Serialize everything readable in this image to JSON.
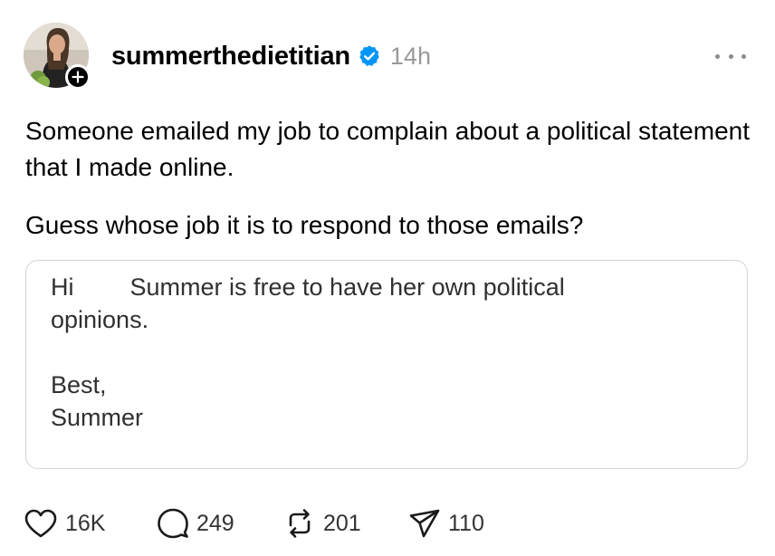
{
  "post": {
    "username": "summerthedietitian",
    "timestamp": "14h",
    "verified": true,
    "paragraphs": [
      "Someone emailed my job to complain about a political statement that I made online.",
      "Guess whose job it is to respond to those emails?"
    ],
    "quote": {
      "greeting": "Hi",
      "line1_rest": "Summer is free to have her own political",
      "line2": "opinions.",
      "signoff": "Best,",
      "signature": "Summer"
    }
  },
  "actions": {
    "likes": "16K",
    "replies": "249",
    "reposts": "201",
    "shares": "110"
  },
  "icons": {
    "verified": "verified-badge-icon",
    "follow": "plus-icon",
    "more": "more-dots-icon",
    "like": "heart-icon",
    "reply": "comment-icon",
    "repost": "repost-icon",
    "share": "send-icon"
  },
  "colors": {
    "verified_blue": "#0095f6",
    "timestamp_gray": "#999999",
    "border_gray": "#d4d4d4"
  }
}
